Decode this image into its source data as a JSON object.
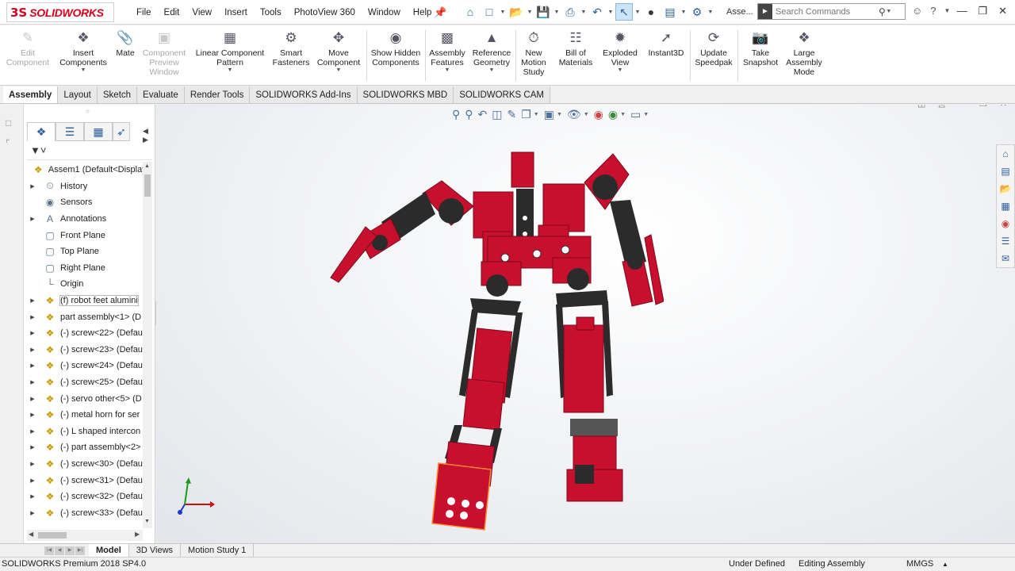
{
  "app": {
    "brand": "SOLIDWORKS",
    "brand_mark": "3S",
    "doc_short": "Asse..."
  },
  "menu": [
    "File",
    "Edit",
    "View",
    "Insert",
    "Tools",
    "PhotoView 360",
    "Window",
    "Help"
  ],
  "search": {
    "placeholder": "Search Commands"
  },
  "ribbon": [
    {
      "label": "Edit Component",
      "icon": "edit-component-icon",
      "enabled": false
    },
    {
      "label": "Insert Components",
      "icon": "insert-components-icon",
      "enabled": true
    },
    {
      "label": "Mate",
      "icon": "mate-icon",
      "enabled": true
    },
    {
      "label": "Component Preview Window",
      "icon": "component-preview-icon",
      "enabled": false
    },
    {
      "label": "Linear Component Pattern",
      "icon": "linear-pattern-icon",
      "enabled": true
    },
    {
      "label": "Smart Fasteners",
      "icon": "smart-fasteners-icon",
      "enabled": true
    },
    {
      "label": "Move Component",
      "icon": "move-component-icon",
      "enabled": true
    },
    {
      "label": "Show Hidden Components",
      "icon": "show-hidden-icon",
      "enabled": true
    },
    {
      "label": "Assembly Features",
      "icon": "assembly-features-icon",
      "enabled": true
    },
    {
      "label": "Reference Geometry",
      "icon": "reference-geometry-icon",
      "enabled": true
    },
    {
      "label": "New Motion Study",
      "icon": "motion-study-icon",
      "enabled": true
    },
    {
      "label": "Bill of Materials",
      "icon": "bom-icon",
      "enabled": true
    },
    {
      "label": "Exploded View",
      "icon": "exploded-view-icon",
      "enabled": true
    },
    {
      "label": "Instant3D",
      "icon": "instant3d-icon",
      "enabled": true
    },
    {
      "label": "Update Speedpak",
      "icon": "speedpak-icon",
      "enabled": true
    },
    {
      "label": "Take Snapshot",
      "icon": "snapshot-icon",
      "enabled": true
    },
    {
      "label": "Large Assembly Mode",
      "icon": "large-assembly-icon",
      "enabled": true
    }
  ],
  "tabs": [
    "Assembly",
    "Layout",
    "Sketch",
    "Evaluate",
    "Render Tools",
    "SOLIDWORKS Add-Ins",
    "SOLIDWORKS MBD",
    "SOLIDWORKS CAM"
  ],
  "tree": {
    "root": "Assem1  (Default<Display",
    "items": [
      {
        "label": "History",
        "icon": "history-icon",
        "expand": true
      },
      {
        "label": "Sensors",
        "icon": "sensors-icon",
        "expand": false
      },
      {
        "label": "Annotations",
        "icon": "annotations-icon",
        "expand": true
      },
      {
        "label": "Front Plane",
        "icon": "plane-icon",
        "expand": false
      },
      {
        "label": "Top Plane",
        "icon": "plane-icon",
        "expand": false
      },
      {
        "label": "Right Plane",
        "icon": "plane-icon",
        "expand": false
      },
      {
        "label": "Origin",
        "icon": "origin-icon",
        "expand": false
      },
      {
        "label": "(f) robot feet alumini",
        "icon": "subassembly-icon",
        "expand": true,
        "highlight": true
      },
      {
        "label": "part assembly<1> (D",
        "icon": "subassembly-icon",
        "expand": true
      },
      {
        "label": "(-) screw<22> (Defau",
        "icon": "subassembly-icon",
        "expand": true
      },
      {
        "label": "(-) screw<23> (Defau",
        "icon": "subassembly-icon",
        "expand": true
      },
      {
        "label": "(-) screw<24> (Defau",
        "icon": "subassembly-icon",
        "expand": true
      },
      {
        "label": "(-) screw<25> (Defau",
        "icon": "subassembly-icon",
        "expand": true
      },
      {
        "label": "(-) servo other<5> (D",
        "icon": "subassembly-icon",
        "expand": true
      },
      {
        "label": "(-) metal horn for ser",
        "icon": "subassembly-icon",
        "expand": true
      },
      {
        "label": "(-) L shaped intercon",
        "icon": "subassembly-icon",
        "expand": true
      },
      {
        "label": "(-) part assembly<2>",
        "icon": "subassembly-icon",
        "expand": true
      },
      {
        "label": "(-) screw<30> (Defau",
        "icon": "subassembly-icon",
        "expand": true
      },
      {
        "label": "(-) screw<31> (Defau",
        "icon": "subassembly-icon",
        "expand": true
      },
      {
        "label": "(-) screw<32> (Defau",
        "icon": "subassembly-icon",
        "expand": true
      },
      {
        "label": "(-) screw<33> (Defau",
        "icon": "subassembly-icon",
        "expand": true
      }
    ]
  },
  "bottom_tabs": [
    "Model",
    "3D Views",
    "Motion Study 1"
  ],
  "status": {
    "product": "SOLIDWORKS Premium 2018 SP4.0",
    "state": "Under Defined",
    "mode": "Editing Assembly",
    "units": "MMGS"
  },
  "colors": {
    "brand_red": "#d6001c",
    "robot_red": "#c8102e",
    "robot_dark": "#2b2b2b",
    "accent_blue": "#2b5e9b"
  }
}
